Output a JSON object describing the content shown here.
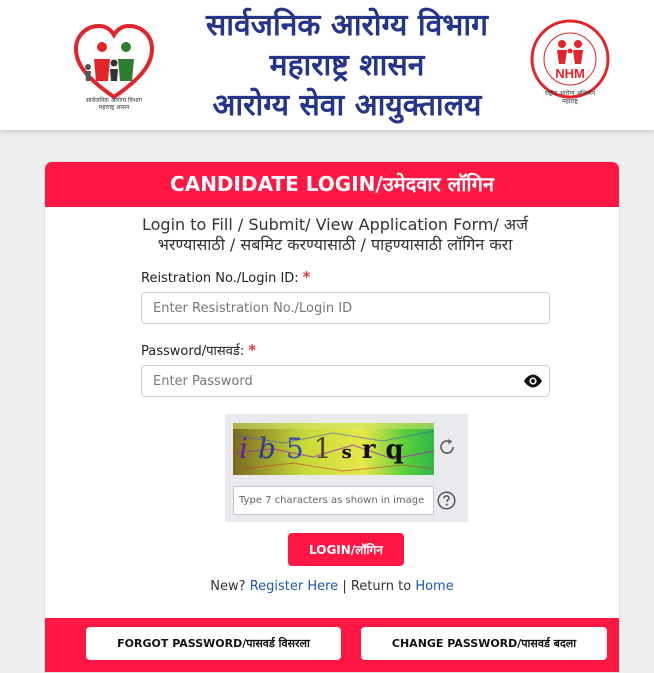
{
  "header": {
    "title_line1": "सार्वजनिक आरोग्य विभाग",
    "title_line2": "महाराष्ट्र शासन",
    "title_line3": "आरोग्य सेवा आयुक्तालय",
    "left_logo_caption_1": "सार्वजनिक आरोग्य विभाग",
    "left_logo_caption_2": "महाराष्ट्र शासन",
    "right_logo_text": "NHM",
    "right_logo_caption_1": "राष्ट्रीय आरोग्य अभियान",
    "right_logo_caption_2": "महाराष्ट्र"
  },
  "card": {
    "heading": "CANDIDATE LOGIN/उमेदवार लॉगिन",
    "subtitle": "Login to Fill / Submit/ View Application Form/ अर्ज भरण्यासाठी / सबमिट करण्यासाठी / पाहण्यासाठी लॉगिन करा"
  },
  "form": {
    "login_label": "Reistration No./Login ID:",
    "login_placeholder": "Enter Resistration No./Login ID",
    "login_value": "",
    "password_label": "Password/पासवर्ड:",
    "password_placeholder": "Enter Password",
    "password_value": "",
    "required_mark": "*"
  },
  "captcha": {
    "text": "ib51srq",
    "placeholder": "Type 7 characters as shown in image",
    "value": ""
  },
  "actions": {
    "login_label": "LOGIN/लॉगिन",
    "new_text": "New?",
    "register_label": "Register Here",
    "separator": "|",
    "return_text": "Return to",
    "home_label": "Home",
    "forgot_label": "FORGOT PASSWORD/पासवर्ड विसरला",
    "change_label": "CHANGE PASSWORD/पासवर्ड बदला"
  },
  "colors": {
    "primary": "#ff1744",
    "title_blue": "#25358a",
    "link": "#1e5aa8"
  }
}
